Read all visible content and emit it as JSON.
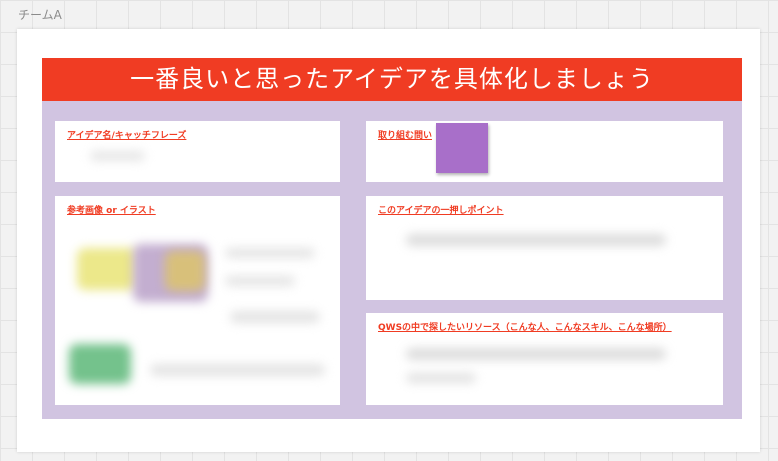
{
  "frame": {
    "label": "チームA"
  },
  "banner": {
    "title": "一番良いと思ったアイデアを具体化しましょう"
  },
  "cards": {
    "idea_name": "アイデア名/キャッチフレーズ",
    "problem": "取り組む問い",
    "reference": "参考画像 or イラスト",
    "point": "このアイデアの一押しポイント",
    "resources": "QWSの中で探したいリソース（こんな人、こんなスキル、こんな場所）"
  },
  "colors": {
    "accent": "#f03c23",
    "board": "#d1c4e1",
    "sticky": "#a86fc9"
  }
}
